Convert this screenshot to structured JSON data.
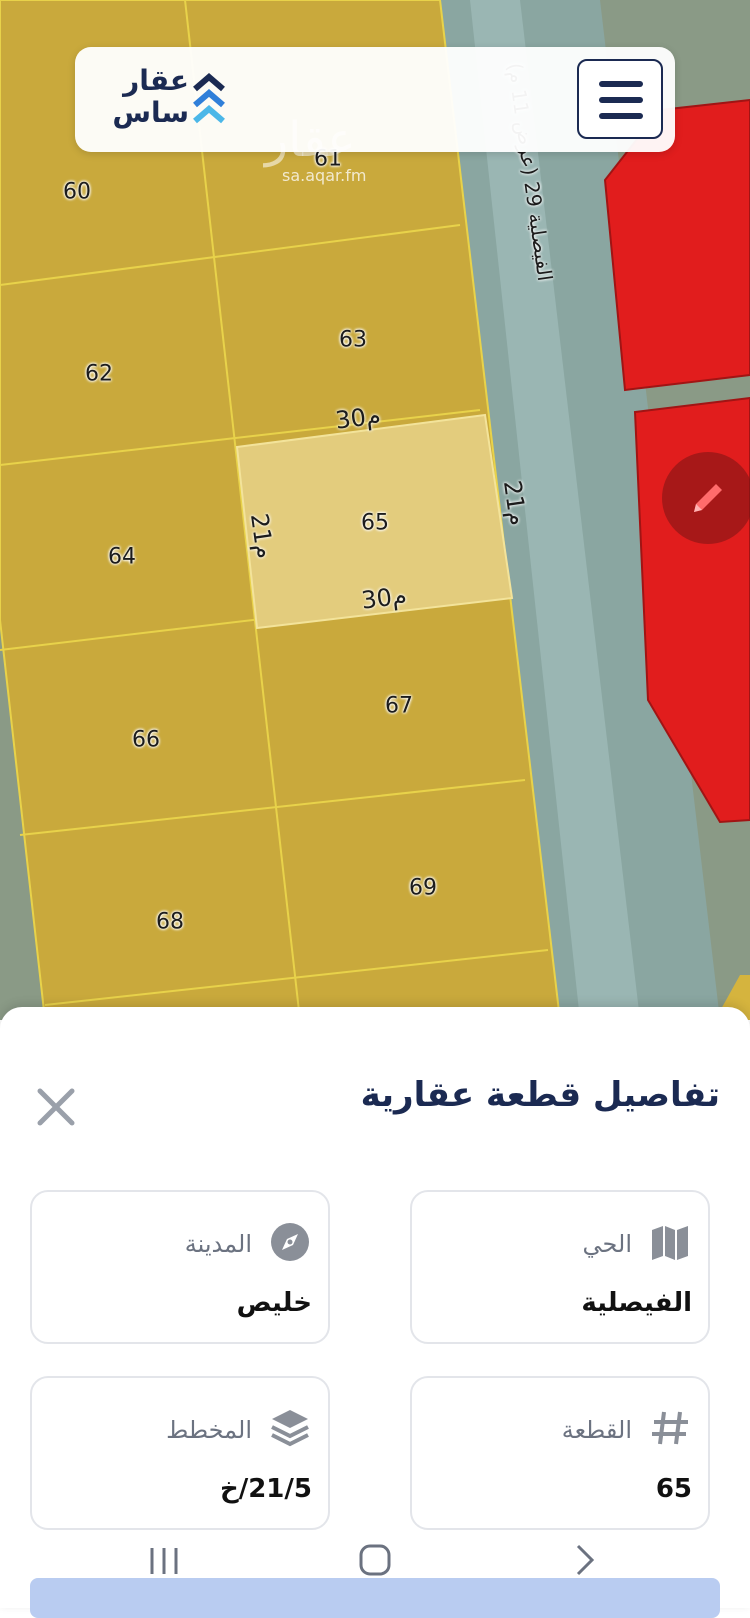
{
  "map": {
    "watermark_text": "عقار",
    "watermark_url": "sa.aqar.fm",
    "street_label": "الفيصلية 29 (عرض 11 م)",
    "lots": [
      {
        "id": "lot-60",
        "number": "60"
      },
      {
        "id": "lot-61",
        "number": "61"
      },
      {
        "id": "lot-62",
        "number": "62"
      },
      {
        "id": "lot-63",
        "number": "63"
      },
      {
        "id": "lot-64",
        "number": "64"
      },
      {
        "id": "lot-65",
        "number": "65",
        "selected": true
      },
      {
        "id": "lot-66",
        "number": "66"
      },
      {
        "id": "lot-67",
        "number": "67"
      },
      {
        "id": "lot-68",
        "number": "68"
      },
      {
        "id": "lot-69",
        "number": "69"
      }
    ],
    "dimensions": {
      "top": "30م",
      "bottom": "30م",
      "left": "21م",
      "right": "21م"
    },
    "colors": {
      "lot_fill": "#c9a93c",
      "selected_lot_fill": "#e3cc7d",
      "reserved_fill": "#e11d1d",
      "lot_border": "#e8d24a"
    }
  },
  "header": {
    "logo_line1": "عقار",
    "logo_line2": "ساس",
    "logo_icon": "stacked-chevrons-icon",
    "menu_icon": "hamburger-menu-icon"
  },
  "fab": {
    "icon": "pencil-icon"
  },
  "sheet": {
    "title": "تفاصيل قطعة عقارية",
    "close_icon": "close-icon",
    "fields": {
      "district": {
        "label": "الحي",
        "value": "الفيصلية",
        "icon": "map-icon"
      },
      "city": {
        "label": "المدينة",
        "value": "خليص",
        "icon": "compass-icon"
      },
      "plot": {
        "label": "القطعة",
        "value": "65",
        "icon": "hash-icon"
      },
      "plan": {
        "label": "المخطط",
        "value": "21/5/خ",
        "icon": "layers-icon"
      }
    }
  },
  "navbar": {
    "recent_icon": "recent-apps-icon",
    "home_icon": "home-icon",
    "back_icon": "back-icon"
  }
}
